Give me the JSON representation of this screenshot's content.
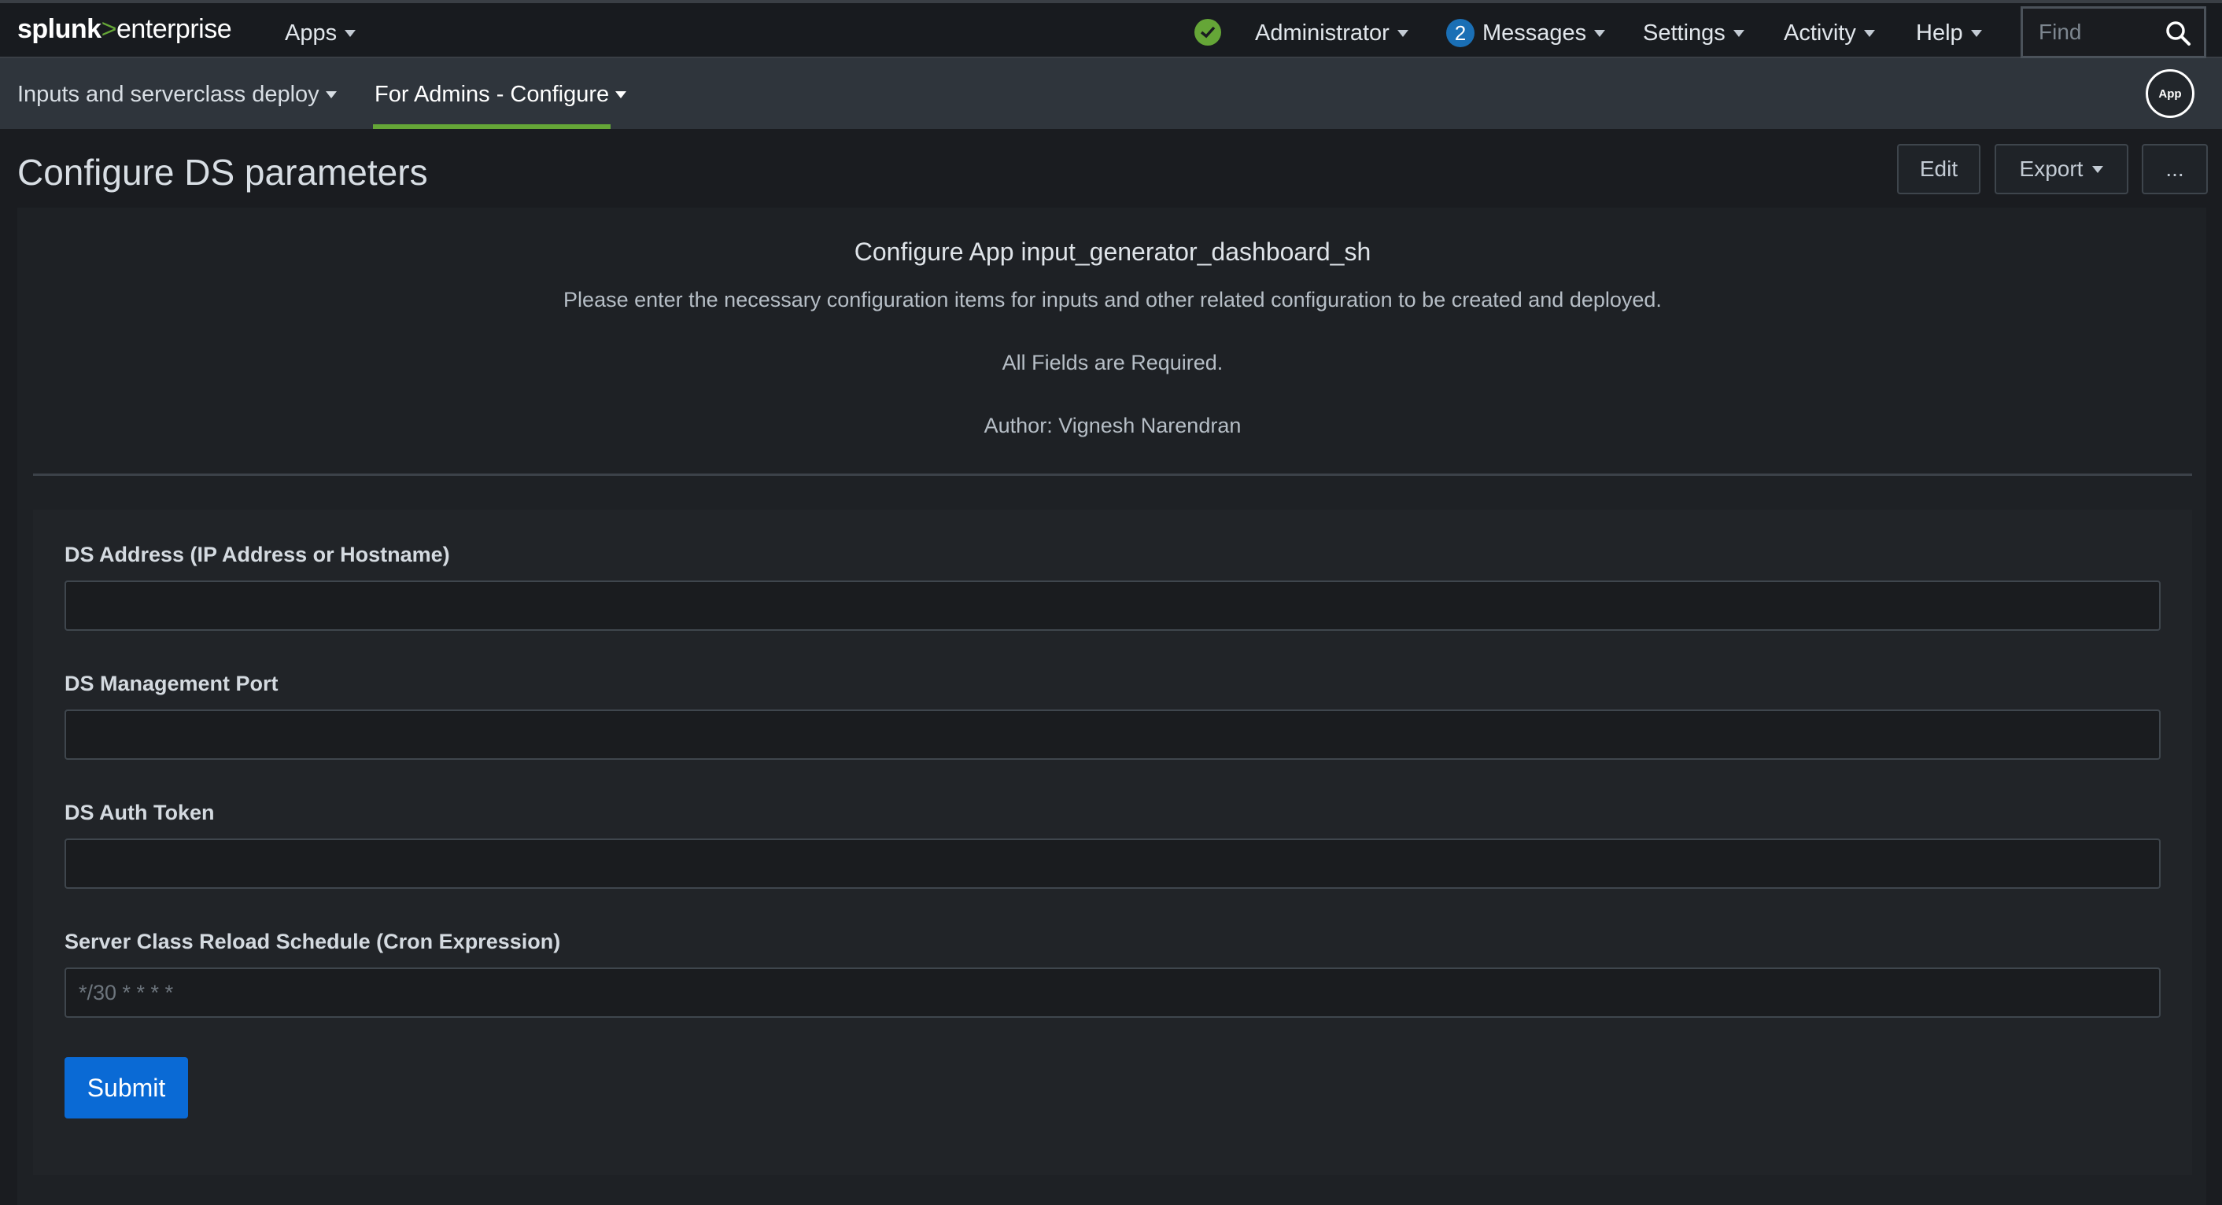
{
  "topbar": {
    "logo_primary": "splunk",
    "logo_separator": ">",
    "logo_secondary": "enterprise",
    "apps_label": "Apps",
    "user_label": "Administrator",
    "messages_count": "2",
    "messages_label": "Messages",
    "settings_label": "Settings",
    "activity_label": "Activity",
    "help_label": "Help",
    "find_placeholder": "Find"
  },
  "appbar": {
    "nav_items": [
      {
        "label": "Inputs and serverclass deploy"
      },
      {
        "label": "For Admins - Configure"
      }
    ],
    "app_icon_label": "App"
  },
  "page": {
    "title": "Configure DS parameters",
    "edit_label": "Edit",
    "export_label": "Export",
    "more_label": "..."
  },
  "info": {
    "title": "Configure App input_generator_dashboard_sh",
    "description": "Please enter the necessary configuration items for inputs and other related configuration to be created and deployed.",
    "required_note": "All Fields are Required.",
    "author": "Author: Vignesh Narendran"
  },
  "form": {
    "fields": [
      {
        "label": "DS Address (IP Address or Hostname)",
        "value": "",
        "placeholder": ""
      },
      {
        "label": "DS Management Port",
        "value": "",
        "placeholder": ""
      },
      {
        "label": "DS Auth Token",
        "value": "",
        "placeholder": ""
      },
      {
        "label": "Server Class Reload Schedule (Cron Expression)",
        "value": "",
        "placeholder": "*/30 * * * *"
      }
    ],
    "submit_label": "Submit"
  },
  "colors": {
    "accent_green": "#65a637",
    "primary_blue": "#0a6ad5",
    "badge_blue": "#1a6fb5"
  }
}
